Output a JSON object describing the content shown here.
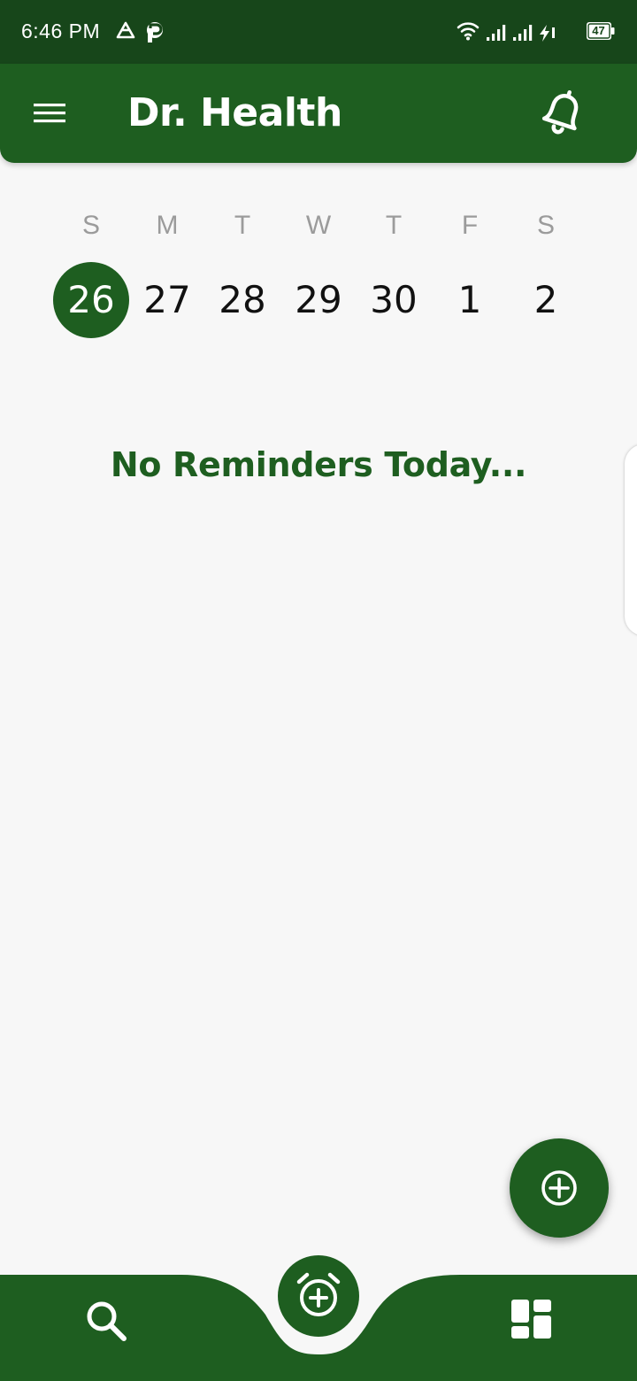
{
  "status_bar": {
    "time": "6:46 PM",
    "battery": "47",
    "icons": [
      "drive-icon",
      "p-app-icon",
      "wifi-icon",
      "signal-icon",
      "signal-icon",
      "charging-icon",
      "battery-icon"
    ]
  },
  "app_bar": {
    "title": "Dr. Health",
    "left_icon": "menu-icon",
    "right_icon": "bell-icon"
  },
  "week": {
    "days": [
      {
        "letter": "S",
        "number": "26",
        "selected": true
      },
      {
        "letter": "M",
        "number": "27",
        "selected": false
      },
      {
        "letter": "T",
        "number": "28",
        "selected": false
      },
      {
        "letter": "W",
        "number": "29",
        "selected": false
      },
      {
        "letter": "T",
        "number": "30",
        "selected": false
      },
      {
        "letter": "F",
        "number": "1",
        "selected": false
      },
      {
        "letter": "S",
        "number": "2",
        "selected": false
      }
    ]
  },
  "content": {
    "empty_message": "No Reminders Today..."
  },
  "fab": {
    "icon": "add-circle-icon"
  },
  "bottom_nav": {
    "left_icon": "search-icon",
    "center_icon": "add-alarm-icon",
    "right_icon": "dashboard-icon"
  },
  "colors": {
    "status_bar": "#17461a",
    "primary": "#1e5e20",
    "background": "#f7f7f7",
    "day_letter": "#9b9b9b"
  }
}
